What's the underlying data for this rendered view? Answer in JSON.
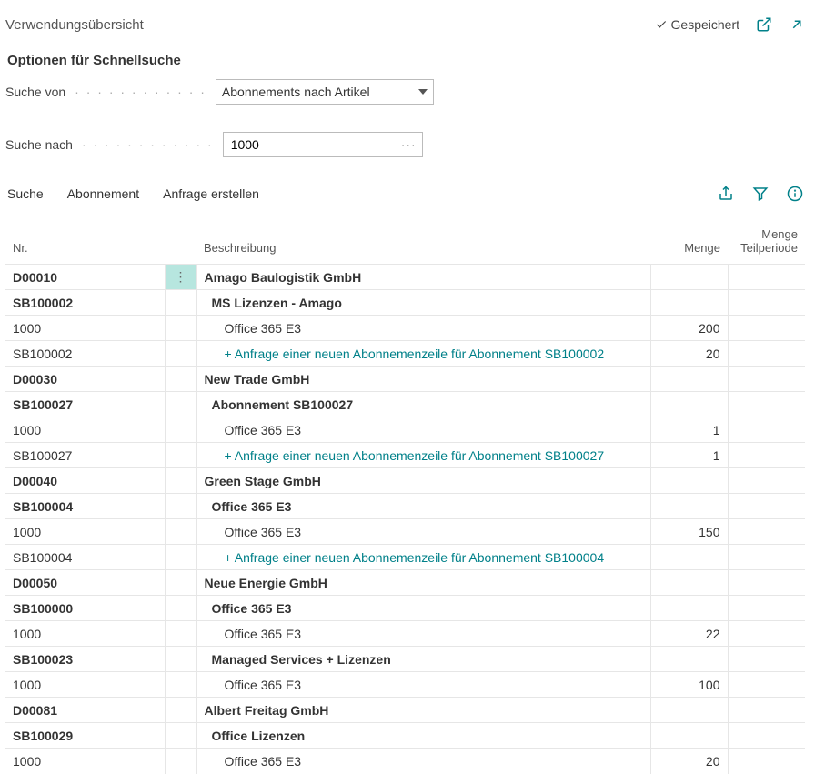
{
  "header": {
    "title": "Verwendungsübersicht",
    "savedLabel": "Gespeichert"
  },
  "quicksearch": {
    "sectionTitle": "Optionen für Schnellsuche",
    "fromLabel": "Suche von",
    "fromValue": "Abonnements nach Artikel",
    "byLabel": "Suche nach",
    "byValue": "1000"
  },
  "toolbar": {
    "search": "Suche",
    "subscription": "Abonnement",
    "createRequest": "Anfrage erstellen"
  },
  "columns": {
    "nr": "Nr.",
    "desc": "Beschreibung",
    "qty": "Menge",
    "qtyPeriod": "Menge Teilperiode"
  },
  "rows": [
    {
      "nr": "D00010",
      "desc": "Amago Baulogistik GmbH",
      "bold": true,
      "indent": 0,
      "link": false,
      "qty": "",
      "firstRow": true
    },
    {
      "nr": "SB100002",
      "desc": "MS Lizenzen - Amago",
      "bold": true,
      "indent": 1,
      "link": false,
      "qty": ""
    },
    {
      "nr": "1000",
      "desc": "Office 365 E3",
      "bold": false,
      "indent": 2,
      "link": false,
      "qty": "200"
    },
    {
      "nr": "SB100002",
      "nrLink": true,
      "desc": "+ Anfrage einer neuen Abonnemenzeile für Abonnement SB100002",
      "bold": false,
      "indent": 2,
      "link": true,
      "qty": "20"
    },
    {
      "nr": "D00030",
      "desc": "New Trade GmbH",
      "bold": true,
      "indent": 0,
      "link": false,
      "qty": ""
    },
    {
      "nr": "SB100027",
      "desc": "Abonnement  SB100027",
      "bold": true,
      "indent": 1,
      "link": false,
      "qty": ""
    },
    {
      "nr": "1000",
      "desc": "Office 365 E3",
      "bold": false,
      "indent": 2,
      "link": false,
      "qty": "1"
    },
    {
      "nr": "SB100027",
      "nrLink": true,
      "desc": "+ Anfrage einer neuen Abonnemenzeile für Abonnement SB100027",
      "bold": false,
      "indent": 2,
      "link": true,
      "qty": "1"
    },
    {
      "nr": "D00040",
      "desc": "Green Stage GmbH",
      "bold": true,
      "indent": 0,
      "link": false,
      "qty": ""
    },
    {
      "nr": "SB100004",
      "desc": "Office 365 E3",
      "bold": true,
      "indent": 1,
      "link": false,
      "qty": ""
    },
    {
      "nr": "1000",
      "desc": "Office 365 E3",
      "bold": false,
      "indent": 2,
      "link": false,
      "qty": "150"
    },
    {
      "nr": "SB100004",
      "nrLink": true,
      "desc": "+ Anfrage einer neuen Abonnemenzeile für Abonnement SB100004",
      "bold": false,
      "indent": 2,
      "link": true,
      "qty": ""
    },
    {
      "nr": "D00050",
      "desc": "Neue Energie GmbH",
      "bold": true,
      "indent": 0,
      "link": false,
      "qty": ""
    },
    {
      "nr": "SB100000",
      "desc": "Office 365 E3",
      "bold": true,
      "indent": 1,
      "link": false,
      "qty": ""
    },
    {
      "nr": "1000",
      "desc": "Office 365 E3",
      "bold": false,
      "indent": 2,
      "link": false,
      "qty": "22"
    },
    {
      "nr": "SB100023",
      "desc": "Managed Services + Lizenzen",
      "bold": true,
      "indent": 1,
      "link": false,
      "qty": ""
    },
    {
      "nr": "1000",
      "desc": "Office 365 E3",
      "bold": false,
      "indent": 2,
      "link": false,
      "qty": "100"
    },
    {
      "nr": "D00081",
      "desc": "Albert Freitag GmbH",
      "bold": true,
      "indent": 0,
      "link": false,
      "qty": ""
    },
    {
      "nr": "SB100029",
      "desc": "Office Lizenzen",
      "bold": true,
      "indent": 1,
      "link": false,
      "qty": ""
    },
    {
      "nr": "1000",
      "desc": "Office 365 E3",
      "bold": false,
      "indent": 2,
      "link": false,
      "qty": "20"
    }
  ],
  "icons": {
    "more": "⋮"
  }
}
